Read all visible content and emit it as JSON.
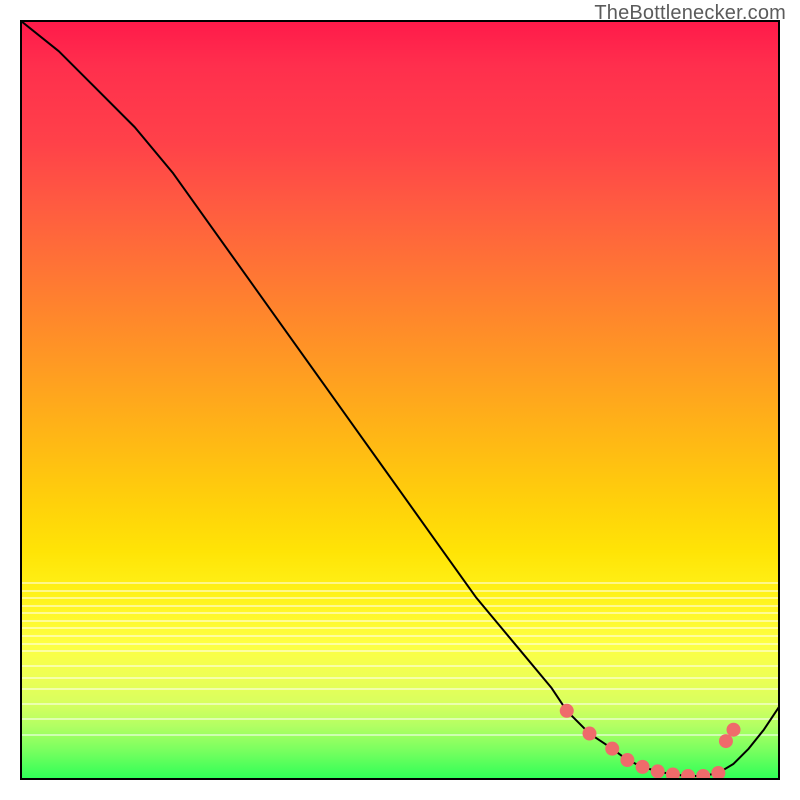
{
  "watermark": "TheBottlenecker.com",
  "chart_data": {
    "type": "line",
    "title": "",
    "xlabel": "",
    "ylabel": "",
    "xlim": [
      0,
      100
    ],
    "ylim": [
      0,
      100
    ],
    "x": [
      0,
      5,
      10,
      15,
      20,
      25,
      30,
      35,
      40,
      45,
      50,
      55,
      60,
      65,
      70,
      72,
      75,
      78,
      80,
      82,
      84,
      86,
      88,
      90,
      92,
      94,
      96,
      98,
      100
    ],
    "y": [
      100,
      96,
      91,
      86,
      80,
      73,
      66,
      59,
      52,
      45,
      38,
      31,
      24,
      18,
      12,
      9,
      6,
      4,
      2.5,
      1.6,
      1.0,
      0.6,
      0.4,
      0.4,
      0.8,
      2.0,
      4.0,
      6.5,
      9.5
    ],
    "marker_points": {
      "x": [
        72,
        75,
        78,
        80,
        82,
        84,
        86,
        88,
        90,
        92,
        93,
        94
      ],
      "y": [
        9.0,
        6.0,
        4.0,
        2.5,
        1.6,
        1.0,
        0.6,
        0.4,
        0.4,
        0.8,
        5.0,
        6.5
      ]
    },
    "background_gradient": {
      "top": "#ff1a4a",
      "mid": "#ffd20a",
      "bottom": "#2eff57"
    }
  }
}
